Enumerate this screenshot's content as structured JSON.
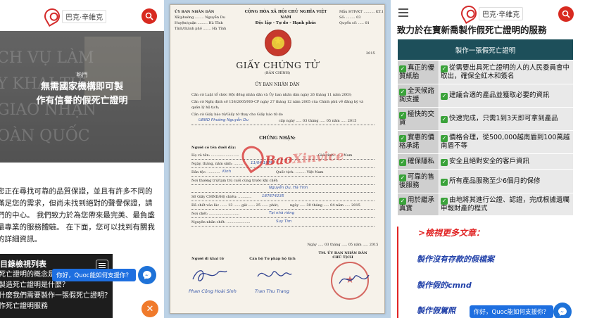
{
  "brand": {
    "name": "巴克·辛維克",
    "accent": "#d82a20"
  },
  "panel1": {
    "hero": {
      "background_text": "CH VỤ LÀM\nY KHAI TỬ\nGIAO NHẠN\nOÀN QUỐC",
      "label": "熱門",
      "title_line1": "無需國家機構即可製",
      "title_line2": "作有信譽的假死亡證明"
    },
    "body_lines": [
      "您正在尋找可靠的品質保證，並且有許多不同的",
      "滿足您的需求，但尚未找到絕對的聲譽保證，請",
      "們的中心。 我們致力於為您帶來最完美、最負盛",
      "最專業的服務體驗。 在下面，您可以找到有關我",
      "的詳細資訊。"
    ],
    "toc": {
      "title": "目錄檢視列表",
      "items": [
        "死亡證明的概念是什",
        "製造死亡證明是什麼？",
        "什麼我們需要製作一張假死亡證明？",
        "作死亡證明服務"
      ]
    },
    "chat_text": "你好，Quoc能如何支援你？"
  },
  "certificate": {
    "header_left": [
      "ỦY BAN NHÂN DÂN",
      "Xã/phường ........ Nguyễn Du",
      "Huyện/quận ......... Hà Tĩnh",
      "Tỉnh/thành phố ....... Hà Tĩnh"
    ],
    "header_center": [
      "CỘNG HÒA XÃ HỘI CHỦ NGHĨA VIỆT NAM",
      "Độc lập - Tự do - Hạnh phúc"
    ],
    "header_right": [
      "Mẫu HTP/KT .......... KT.1",
      "Số: ........ 03",
      "Quyển số: ..... 01"
    ],
    "year_small": "2015",
    "title": "GIẤY CHỨNG TỬ",
    "subtitle": "(BẢN CHÍNH)",
    "org": "ỦY BAN NHÂN DÂN",
    "paragraphs": [
      "Căn cứ Luật tổ chức Hội đồng nhân dân và Ủy ban nhân dân ngày 26 tháng 11 năm 2003;",
      "Căn cứ Nghị định số 158/2005/NĐ-CP ngày 27 tháng 12 năm 2005 của Chính phủ về đăng ký và quản lý hộ tịch;",
      "Căn cứ Giấy báo tử/Giấy tờ thay cho Giấy báo tử do"
    ],
    "issuer_line": {
      "value": "UBND Phường Nguyễn Du",
      "date_label": "cấp ngày ..... 03 tháng ..... 05 năm ..... 2015"
    },
    "certifies": "CHỨNG NHẬN:",
    "fields": [
      {
        "label": "Người có tên dưới đây:",
        "value": "",
        "extra": ""
      },
      {
        "label": "Họ và tên: .........................",
        "value": "",
        "extra": "Giới tính: ...... Nam"
      },
      {
        "label": "Ngày, tháng, năm sinh: ........",
        "value": "11/04/1976",
        "extra": ""
      },
      {
        "label": "Dân tộc: ...........",
        "value": "Kinh",
        "extra": "Quốc tịch: ......... Việt Nam"
      },
      {
        "label": "Nơi thường trú/tạm trú cuối cùng trước khi chết:",
        "value": "",
        "extra": ""
      },
      {
        "label": "",
        "value": "Nguyễn Du, Hà Tĩnh",
        "extra": ""
      },
      {
        "label": "Số Giấy CMND/Hộ chiếu: ............",
        "value": "187674235",
        "extra": ""
      },
      {
        "label": "Đã chết vào lúc ...... 13 ...... giờ ...... 25 ...... phút,",
        "value": "",
        "extra": "ngày ..... 30 tháng ..... 04 năm ..... 2015"
      },
      {
        "label": "Nơi chết: ...........................",
        "value": "Tại nhà riêng",
        "extra": ""
      },
      {
        "label": "Nguyên nhân chết: .....................",
        "value": "Suy Tim",
        "extra": ""
      }
    ],
    "date_line": "Ngày ..... 03 tháng ..... 05 năm ..... 2015",
    "sign_center": [
      "TM. ỦY BAN NHÂN DÂN",
      "CHỦ TỊCH"
    ],
    "sign_left": "Người đi khai tử",
    "sign_mid": "Cán bộ Tư pháp hộ tịch",
    "signer_left": "Phan Công Hoài Sinh",
    "signer_mid": "Tran Thu Trang",
    "watermark_main": "Bao",
    "watermark_light": "Xinvice"
  },
  "panel3": {
    "heading": "致力於在寶新喬製作假死亡證明的服務",
    "table_header": "製作一張假死亡證明",
    "rows": [
      {
        "label": "真正的優質紙胎",
        "desc": "從需要出具死亡證明的人的人民委員會中取出，確保全紅木和簽名"
      },
      {
        "label": "全天候諮詢支援",
        "desc": "建議合適的產品並獲取必要的資訊"
      },
      {
        "label": "極快的交貨",
        "desc": "快速完成，只需1到3天即可拿到產品"
      },
      {
        "label": "實惠的價格承諾",
        "desc": "價格合理，從500,000越南盾到100萬越南盾不等"
      },
      {
        "label": "確保隱私",
        "desc": "安全且絕對安全的客戶資訊"
      },
      {
        "label": "可靠的售後服務",
        "desc": "所有產品服務至少6個月的保修"
      },
      {
        "label": "用於繼承真實",
        "desc": "由地將其進行公證、認證，完成根據遺囑申報財產的程式"
      }
    ],
    "more_title": ">檢視更多文章：",
    "articles": [
      "製作沒有存款的假檔案",
      "製作假的cmnd",
      "製作假駕照"
    ],
    "chat_text": "你好，Quoc能如何支援你？"
  }
}
